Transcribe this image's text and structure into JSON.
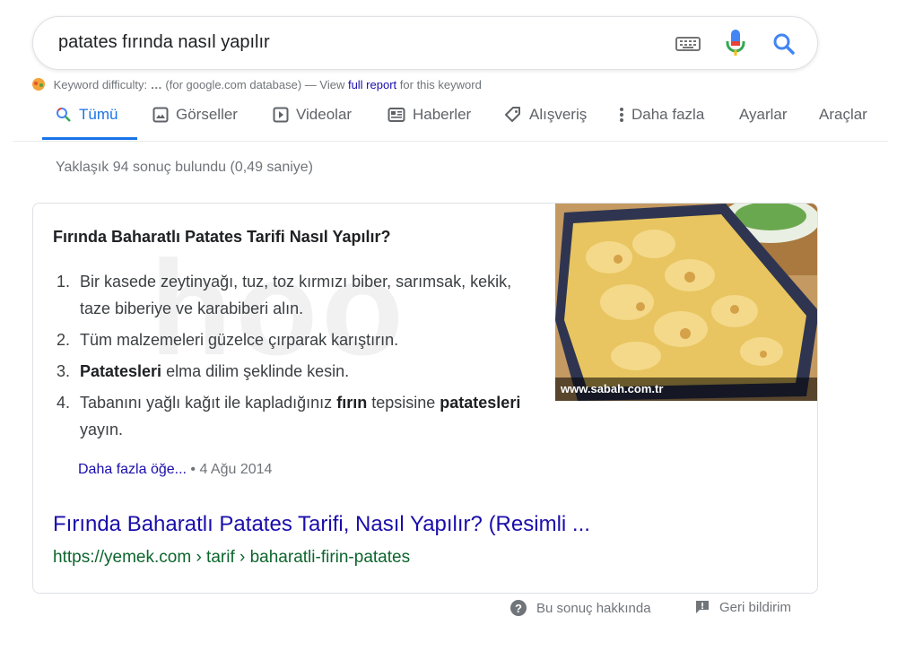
{
  "search": {
    "query": "patates fırında nasıl yapılır"
  },
  "seo_bar": {
    "label": "Keyword difficulty:",
    "value": "…",
    "database": "(for google.com database) — View",
    "link": "full report",
    "suffix": "for this keyword"
  },
  "tabs": {
    "all": "Tümü",
    "images": "Görseller",
    "videos": "Videolar",
    "news": "Haberler",
    "shopping": "Alışveriş",
    "more": "Daha fazla",
    "settings": "Ayarlar",
    "tools": "Araçlar"
  },
  "result_stats": "Yaklaşık 94 sonuç bulundu (0,49 saniye)",
  "snippet": {
    "title": "Fırında Baharatlı Patates Tarifi Nasıl Yapılır?",
    "steps": [
      {
        "num": "1.",
        "parts": [
          "Bir kasede zeytinyağı, tuz, toz kırmızı biber, sarımsak, kekik, taze biberiye ve karabiberi alın."
        ]
      },
      {
        "num": "2.",
        "parts": [
          "Tüm malzemeleri güzelce çırparak karıştırın."
        ]
      },
      {
        "num": "3.",
        "bold1": "Patatesleri",
        "rest": "elma dilim şeklinde kesin."
      },
      {
        "num": "4.",
        "pre": "Tabanını yağlı kağıt ile kapladığınız",
        "bold1": "fırın",
        "mid": "tepsisine",
        "bold2": "patatesleri",
        "post": "yayın."
      }
    ],
    "more_link": "Daha fazla öğe...",
    "date": "4 Ağu 2014",
    "image_caption": "www.sabah.com.tr",
    "watermark": "hoo",
    "result_title": "Fırında Baharatlı Patates Tarifi, Nasıl Yapılır? (Resimli ...",
    "result_url": "https://yemek.com › tarif › baharatli-firin-patates"
  },
  "footer": {
    "about": "Bu sonuç hakkında",
    "feedback": "Geri bildirim"
  },
  "colors": {
    "link": "#1a0dab",
    "url_green": "#0d652d",
    "accent_blue": "#1a73e8"
  }
}
